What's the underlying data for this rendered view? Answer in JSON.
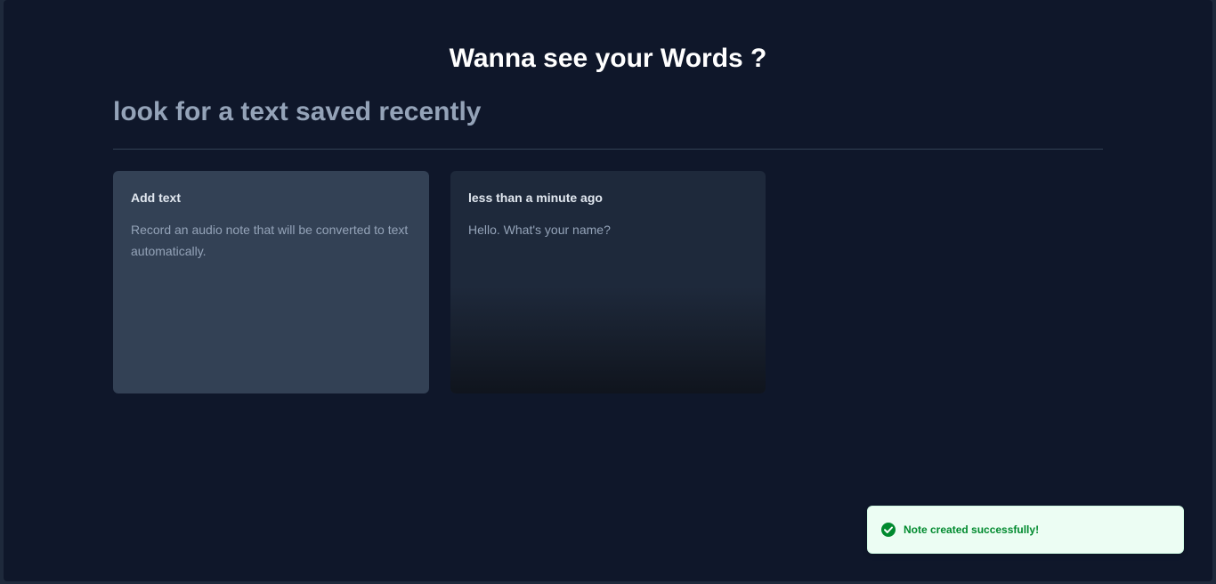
{
  "page": {
    "title": "Wanna see your Words ?"
  },
  "search": {
    "placeholder": "look for a text saved recently"
  },
  "cards": [
    {
      "title": "Add text",
      "text": "Record an audio note that will be converted to text automatically."
    },
    {
      "title": "less than a minute ago",
      "text": "Hello. What's your name?"
    }
  ],
  "toast": {
    "message": "Note created successfully!",
    "icon": "check-circle-icon",
    "color": "#008a2e"
  },
  "colors": {
    "background": "#0f172a",
    "card_add": "#334155",
    "card_note": "#1e293b"
  }
}
